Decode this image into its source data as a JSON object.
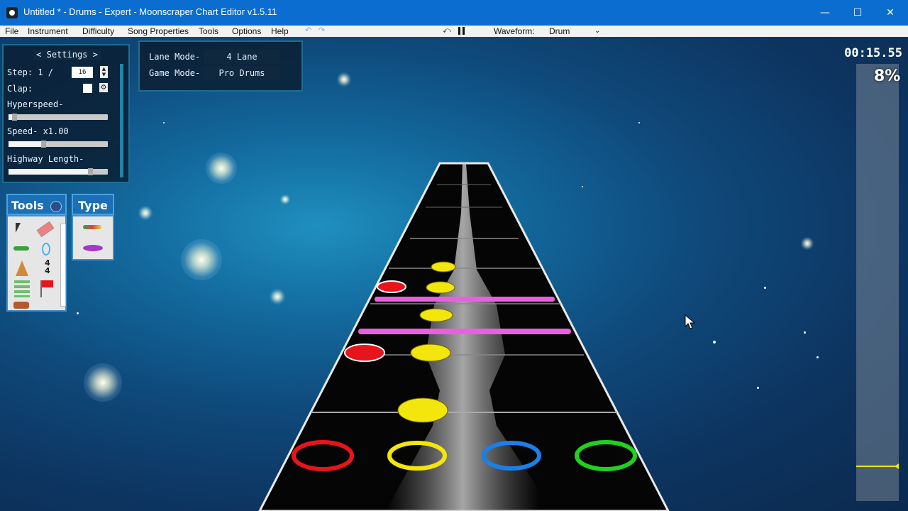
{
  "window": {
    "title": "Untitled * - Drums - Expert - Moonscraper Chart Editor v1.5.11",
    "controls": {
      "minimize": "—",
      "maximize": "☐",
      "close": "✕"
    }
  },
  "menu": {
    "items": [
      "File",
      "Instrument",
      "Difficulty",
      "Song Properties",
      "Tools",
      "Options",
      "Help"
    ],
    "waveform_label": "Waveform:",
    "waveform_value": "Drum"
  },
  "settings": {
    "header": "< Settings >",
    "step_label": "Step: 1 /",
    "step_value": "16",
    "clap_label": "Clap:",
    "hyperspeed_label": "Hyperspeed-",
    "hyperspeed_level": 0.06,
    "speed_label": "Speed- x1.00",
    "speed_level": 0.35,
    "highway_label": "Highway Length-",
    "highway_level": 0.82
  },
  "mode_panel": {
    "lane_mode_label": "Lane Mode-",
    "lane_mode_value": "4 Lane",
    "game_mode_label": "Game Mode-",
    "game_mode_value": "Pro Drums"
  },
  "tools_panel": {
    "title": "Tools",
    "icons": [
      "cursor-icon",
      "eraser-icon",
      "note-icon",
      "bpm-icon",
      "timesig-icon",
      "section-flag-icon",
      "event-icon",
      "drum-icon"
    ],
    "timesig_text": "4\n4"
  },
  "type_panel": {
    "title": "Type",
    "icons": [
      "note-type-icon",
      "cymbal-type-icon"
    ]
  },
  "playback": {
    "time": "00:15.55",
    "progress_text": "8%",
    "progress": 0.08
  },
  "colors": {
    "lane_red": "#e8141c",
    "lane_yellow": "#f2e60c",
    "lane_blue": "#1b7fe8",
    "lane_green": "#1ed21e",
    "kick_bar": "#e860e0",
    "accent": "#0a6dcf"
  }
}
